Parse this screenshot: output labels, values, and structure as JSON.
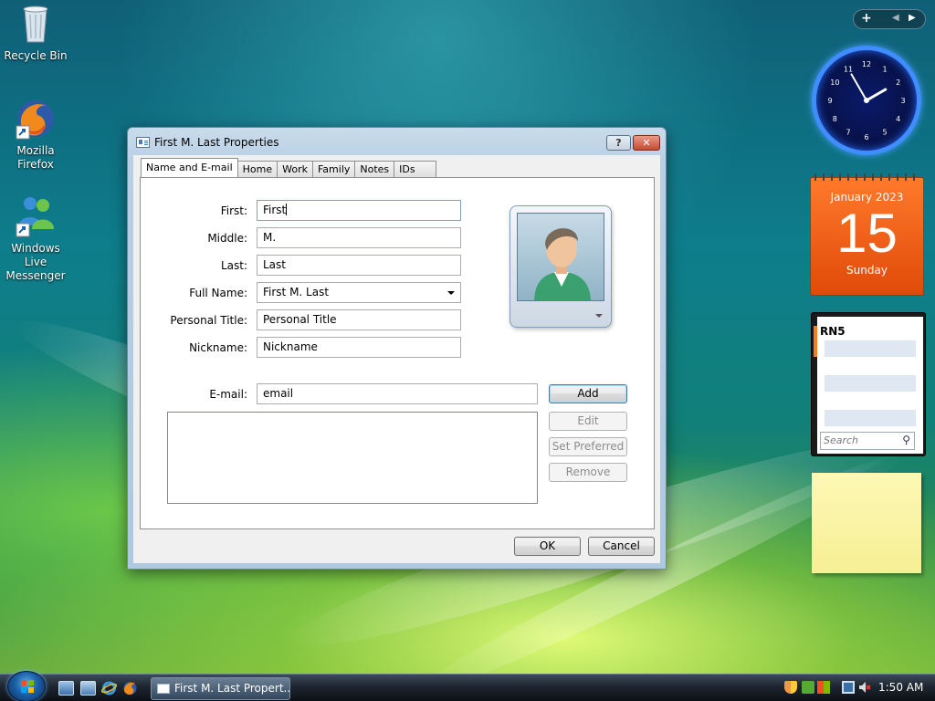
{
  "desktop": {
    "icons": [
      {
        "label": "Recycle Bin"
      },
      {
        "label": "Mozilla Firefox"
      },
      {
        "label": "Windows Live Messenger"
      }
    ]
  },
  "window": {
    "title": "First M. Last Properties",
    "help_label": "?",
    "close_label": "✕",
    "tabs": [
      {
        "label": "Name and E-mail",
        "active": true
      },
      {
        "label": "Home"
      },
      {
        "label": "Work"
      },
      {
        "label": "Family"
      },
      {
        "label": "Notes"
      },
      {
        "label": "IDs"
      }
    ],
    "fields": {
      "first": {
        "label": "First:",
        "value": "First"
      },
      "middle": {
        "label": "Middle:",
        "value": "M."
      },
      "last": {
        "label": "Last:",
        "value": "Last"
      },
      "full_name": {
        "label": "Full Name:",
        "value": "First M. Last"
      },
      "personal_title": {
        "label": "Personal Title:",
        "value": "Personal Title"
      },
      "nickname": {
        "label": "Nickname:",
        "value": "Nickname"
      },
      "email": {
        "label": "E-mail:",
        "value": "email"
      }
    },
    "buttons": {
      "add": "Add",
      "edit": "Edit",
      "set_preferred": "Set Preferred",
      "remove": "Remove",
      "ok": "OK",
      "cancel": "Cancel"
    }
  },
  "gadgets": {
    "clock": {
      "numbers": [
        "12",
        "1",
        "2",
        "3",
        "4",
        "5",
        "6",
        "7",
        "8",
        "9",
        "10",
        "11"
      ]
    },
    "calendar": {
      "month_year": "January 2023",
      "day": "15",
      "weekday": "Sunday"
    },
    "contacts": {
      "title": "RN5",
      "search_placeholder": "Search"
    }
  },
  "taskbar": {
    "task_label": "First M. Last Propert...",
    "time": "1:50 AM"
  },
  "colors": {
    "accent": "#3c7fb1",
    "calendar": "#ff6a1a",
    "clock_ring": "#3f8dff"
  }
}
